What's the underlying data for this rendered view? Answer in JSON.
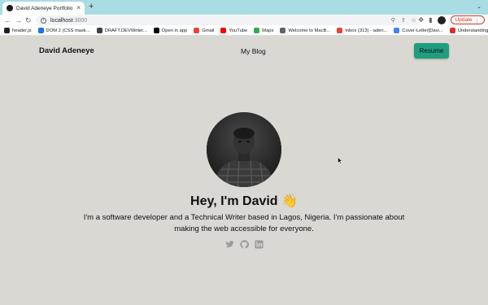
{
  "browser": {
    "tab": {
      "title": "David Adeneye Portfolio"
    },
    "url": {
      "host": "localhost",
      "port": ":3000"
    },
    "update_label": "Update",
    "bookmarks": [
      {
        "label": "header.js",
        "color": "#202124"
      },
      {
        "label": "DOM 2 (CSS mask...",
        "color": "#1a73e8"
      },
      {
        "label": "DRAFT.DEVWriter...",
        "color": "#3c4043"
      },
      {
        "label": "Open in app",
        "color": "#000000"
      },
      {
        "label": "Gmail",
        "color": "#ea4335"
      },
      {
        "label": "YouTube",
        "color": "#ff0000"
      },
      {
        "label": "Maps",
        "color": "#34a853"
      },
      {
        "label": "Welcome to MacB...",
        "color": "#5f6368"
      },
      {
        "label": "Inbox (313) - aden...",
        "color": "#ea4335"
      },
      {
        "label": "Cover-Letter[Davi...",
        "color": "#4285f4"
      },
      {
        "label": "Understanding An...",
        "color": "#d93025"
      }
    ]
  },
  "nav": {
    "brand": "David Adeneye",
    "blog_label": "My Blog",
    "resume_label": "Resume"
  },
  "hero": {
    "title": "Hey, I'm David 👋",
    "description": "I'm a software developer and a Technical Writer based in Lagos, Nigeria. I'm passionate about making the web accessible for everyone."
  },
  "socials": [
    {
      "icon": "twitter-icon"
    },
    {
      "icon": "github-icon"
    },
    {
      "icon": "linkedin-icon"
    }
  ],
  "colors": {
    "page_bg": "#d9d8d3",
    "accent": "#1e9e7f",
    "tabstrip": "#a8dde3",
    "update": "#d93025"
  }
}
